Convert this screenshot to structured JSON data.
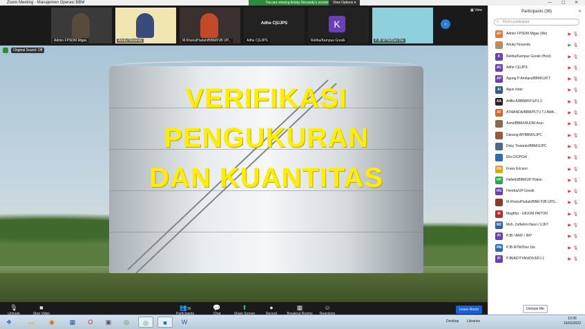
{
  "window": {
    "title": "Zoom Meeting - Manajemen Operasi BBM",
    "banner": "You are viewing Arluky Novandy's screen",
    "view_options": "View Options ▾",
    "controls": "—  ▢  ✕"
  },
  "strip": {
    "view_label": "▦ View",
    "tiles": [
      {
        "name": "Admin FPSDM Migas",
        "color": "#5a4a3a"
      },
      {
        "name": "Arluky Novandy",
        "color": "#e8c24a"
      },
      {
        "name": "M.KhoirulHudah/BBM/PJB UP...",
        "color": "#7a3a2a"
      },
      {
        "name": "Adhe C|UJPS",
        "center": "Adhe C|UJPS"
      },
      {
        "name": "Reliha/Kampus Gresik",
        "letter": "K"
      },
      {
        "name": "PJB MTW/Deri Dw",
        "color": "#5fb6c9"
      }
    ]
  },
  "share": {
    "line1": "VERIFIKASI",
    "line2": "PENGUKURAN",
    "line3": "DAN KUANTITAS",
    "original_sound": "Original Sound: Off"
  },
  "controls": {
    "unmute": "Unmute",
    "stop_video": "Stop Video",
    "participants": "Participants",
    "participants_count": "36",
    "chat": "Chat",
    "share_screen": "Share Screen",
    "record": "Record",
    "breakout": "Breakout Rooms",
    "reactions": "Reactions",
    "leave": "Leave Room"
  },
  "panel": {
    "title": "Participants (36)",
    "search_placeholder": "Find a participant",
    "unmute_me": "Unmute Me",
    "participants": [
      {
        "initials": "AP",
        "name": "Admin FPSDM Migas (Me)",
        "color": "#e07a3a"
      },
      {
        "initials": "",
        "name": "Arluky Novandy",
        "color": "#c08a5a",
        "video": true
      },
      {
        "initials": "K",
        "name": "Reliha/Kampus Gresik (Host)",
        "color": "#6a3fb8"
      },
      {
        "initials": "AC",
        "name": "Adhe C|UJPS",
        "color": "#6a3fb8"
      },
      {
        "initials": "AP",
        "name": "Agung P Ambara/BBM/UJKT",
        "color": "#6a3fb8"
      },
      {
        "initials": "AI",
        "name": "Agus Istari",
        "color": "#2b5f8a"
      },
      {
        "initials": "AA",
        "name": "Aliffia A/BBM/KP EPJ-2",
        "color": "#222"
      },
      {
        "initials": "AT",
        "name": "ATMANDA/BBM/PLTU TJ AWA...",
        "color": "#d9641e"
      },
      {
        "initials": "",
        "name": "Azmi/BBM/UBJOM Arun",
        "color": "#8a6a4a"
      },
      {
        "initials": "",
        "name": "Danang AP/BBM/UJPC",
        "color": "#9a5a3a"
      },
      {
        "initials": "",
        "name": "Deky Tristanto/BBM/UJPC",
        "color": "#4a6a8a"
      },
      {
        "initials": "",
        "name": "Eko D/UPGrk",
        "color": "#2b6ab8"
      },
      {
        "initials": "FE",
        "name": "Frans Ericson",
        "color": "#e8a020"
      },
      {
        "initials": "HP",
        "name": "Hafieth/BBM/UP Paiton",
        "color": "#2ea34a"
      },
      {
        "initials": "HG",
        "name": "Hendra/UP Gresik",
        "color": "#6a3fb8"
      },
      {
        "initials": "",
        "name": "M.KhoirulHudah/BBM PJB UPG...",
        "color": "#8a3a2a"
      },
      {
        "initials": "M",
        "name": "Maghfur - UBJOM PAITON",
        "color": "#b82a2a"
      },
      {
        "initials": "MZ",
        "name": "Muh. Zulfahmi Nasri / UJKT",
        "color": "#2b5fb8"
      },
      {
        "initials": "P/",
        "name": "PJB / ARIF / IMY",
        "color": "#6a3fb8"
      },
      {
        "initials": "PM",
        "name": "PJB MTW/Deri Dw",
        "color": "#2b6ab8"
      },
      {
        "initials": "P/",
        "name": "PJB/ADITYAN/DIVEPJ-1",
        "color": "#6a3fb8"
      }
    ]
  },
  "taskbar": {
    "desktop": "Desktop",
    "libraries": "Libraries",
    "time": "10:36",
    "date": "16/02/2022"
  }
}
